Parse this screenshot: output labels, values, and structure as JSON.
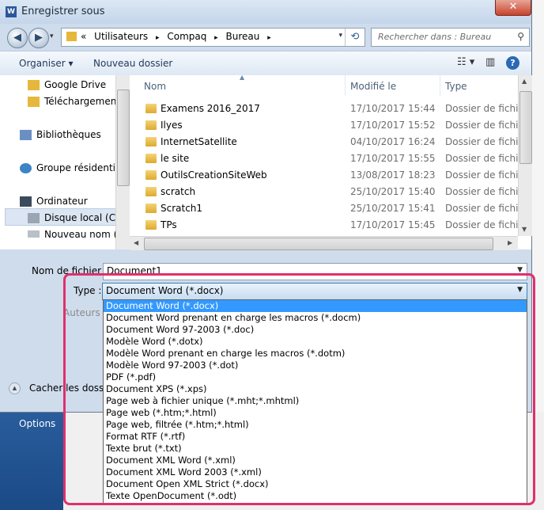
{
  "window": {
    "title": "Enregistrer sous",
    "app_icon": "W",
    "close": "✕"
  },
  "nav": {
    "back_icon": "◀",
    "forward_icon": "▶",
    "history_icon": "▾",
    "crumbs": [
      "«",
      "Utilisateurs",
      "▸",
      "Compaq",
      "▸",
      "Bureau",
      "▸"
    ],
    "refresh_icon": "⟲",
    "search_placeholder": "Rechercher dans : Bureau"
  },
  "toolbar": {
    "organize": "Organiser ▾",
    "new_folder": "Nouveau dossier",
    "views_icon": "☷ ▾",
    "layout_icon": "▥",
    "help": "?"
  },
  "sidebar": {
    "items": [
      "Google Drive",
      "Téléchargements",
      "Bibliothèques",
      "Groupe résidentiel",
      "Ordinateur",
      "Disque local (C:)",
      "Nouveau nom (G"
    ]
  },
  "files": {
    "headers": [
      "Nom",
      "Modifié le",
      "Type"
    ],
    "rows": [
      {
        "name": "Examens 2016_2017",
        "date": "17/10/2017 15:44",
        "type": "Dossier de fichiers"
      },
      {
        "name": "Ilyes",
        "date": "17/10/2017 15:52",
        "type": "Dossier de fichiers"
      },
      {
        "name": "InternetSatellite",
        "date": "04/10/2017 16:24",
        "type": "Dossier de fichiers"
      },
      {
        "name": "le site",
        "date": "17/10/2017 15:55",
        "type": "Dossier de fichiers"
      },
      {
        "name": "OutilsCreationSiteWeb",
        "date": "13/08/2017 18:23",
        "type": "Dossier de fichiers"
      },
      {
        "name": "scratch",
        "date": "25/10/2017 15:40",
        "type": "Dossier de fichiers"
      },
      {
        "name": "Scratch1",
        "date": "25/10/2017 15:41",
        "type": "Dossier de fichiers"
      },
      {
        "name": "TPs",
        "date": "17/10/2017 15:45",
        "type": "Dossier de fichiers"
      }
    ]
  },
  "form": {
    "filename_label": "Nom de fichier :",
    "filename_value": "Document1",
    "type_label": "Type :",
    "type_value": "Document Word (*.docx)",
    "authors_label": "Auteurs :",
    "hide_folders": "Cacher les dossier"
  },
  "type_options": [
    "Document Word (*.docx)",
    "Document Word prenant en charge les macros (*.docm)",
    "Document Word 97-2003 (*.doc)",
    "Modèle Word (*.dotx)",
    "Modèle Word prenant en charge les macros (*.dotm)",
    "Modèle Word 97-2003 (*.dot)",
    "PDF (*.pdf)",
    "Document XPS (*.xps)",
    "Page web à fichier unique (*.mht;*.mhtml)",
    "Page web (*.htm;*.html)",
    "Page web, filtrée (*.htm;*.html)",
    "Format RTF (*.rtf)",
    "Texte brut (*.txt)",
    "Document XML Word (*.xml)",
    "Document XML Word 2003 (*.xml)",
    "Document Open XML Strict (*.docx)",
    "Texte OpenDocument (*.odt)"
  ],
  "background": {
    "options": "Options"
  },
  "colors": {
    "selection": "#3399ff",
    "annotation": "#e0306c",
    "folder": "#e5b73b"
  }
}
